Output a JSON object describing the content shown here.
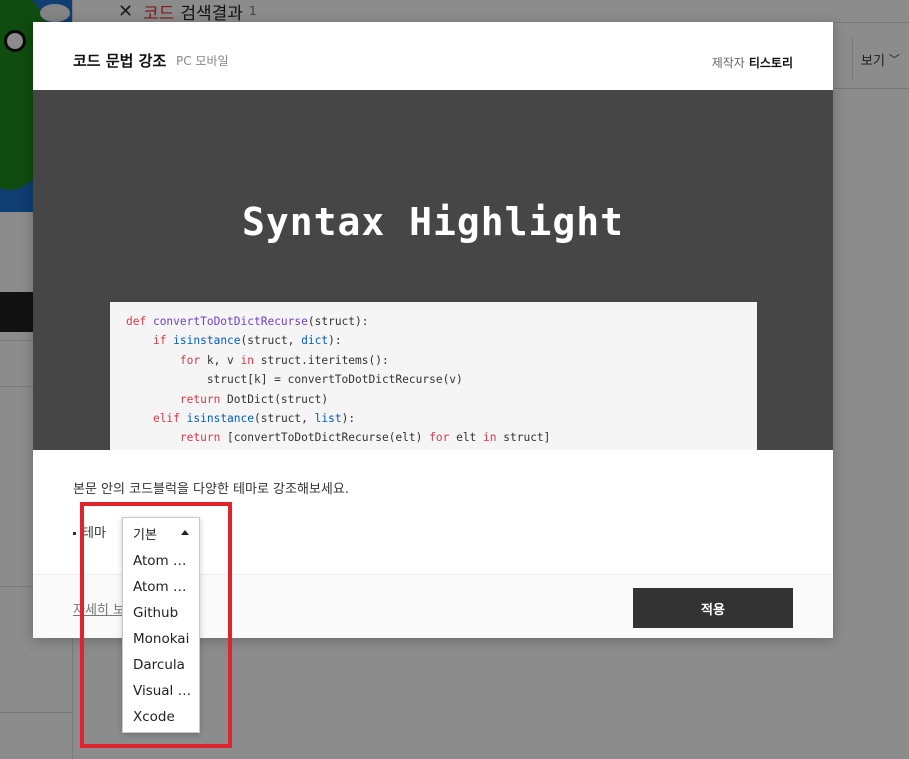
{
  "background": {
    "search_close_glyph": "✕",
    "search_keyword": "코드",
    "search_title": "검색결과",
    "search_count": "1",
    "view_label": "보기",
    "view_chevron": "﹀"
  },
  "modal": {
    "title": "코드 문법 강조",
    "platform": "PC 모바일",
    "maker_label": "제작자",
    "maker_name": "티스토리",
    "preview_heading": "Syntax Highlight",
    "description": "본문 안의 코드블럭을 다양한 테마로 강조해보세요.",
    "theme_label": "테마",
    "more_link": "자세히 보기",
    "apply_button": "적용"
  },
  "code_lines": [
    [
      {
        "t": "def ",
        "c": "kw-red"
      },
      {
        "t": "convertToDotDictRecurse",
        "c": "fn-purple"
      },
      {
        "t": "(struct):",
        "c": ""
      }
    ],
    [
      {
        "t": "    ",
        "c": ""
      },
      {
        "t": "if ",
        "c": "kw-red"
      },
      {
        "t": "isinstance",
        "c": "bi-blue"
      },
      {
        "t": "(struct, ",
        "c": ""
      },
      {
        "t": "dict",
        "c": "bi-blue"
      },
      {
        "t": "):",
        "c": ""
      }
    ],
    [
      {
        "t": "        ",
        "c": ""
      },
      {
        "t": "for ",
        "c": "kw-red"
      },
      {
        "t": "k, v ",
        "c": ""
      },
      {
        "t": "in ",
        "c": "kw-red"
      },
      {
        "t": "struct.iteritems():",
        "c": ""
      }
    ],
    [
      {
        "t": "            struct[k] = convertToDotDictRecurse(v)",
        "c": ""
      }
    ],
    [
      {
        "t": "        ",
        "c": ""
      },
      {
        "t": "return ",
        "c": "kw-red"
      },
      {
        "t": "DotDict(struct)",
        "c": ""
      }
    ],
    [
      {
        "t": "    ",
        "c": ""
      },
      {
        "t": "elif ",
        "c": "kw-red"
      },
      {
        "t": "isinstance",
        "c": "bi-blue"
      },
      {
        "t": "(struct, ",
        "c": ""
      },
      {
        "t": "list",
        "c": "bi-blue"
      },
      {
        "t": "):",
        "c": ""
      }
    ],
    [
      {
        "t": "        ",
        "c": ""
      },
      {
        "t": "return ",
        "c": "kw-red"
      },
      {
        "t": "[convertToDotDictRecurse(elt) ",
        "c": ""
      },
      {
        "t": "for ",
        "c": "kw-red"
      },
      {
        "t": "elt ",
        "c": ""
      },
      {
        "t": "in ",
        "c": "kw-red"
      },
      {
        "t": "struct]",
        "c": ""
      }
    ]
  ],
  "dropdown": {
    "selected": "기본",
    "options": [
      "Atom One Light",
      "Atom One Dark",
      "Github",
      "Monokai",
      "Darcula",
      "Visual Studio",
      "Xcode"
    ]
  },
  "colors": {
    "annotation": "#e0242b",
    "apply_bg": "#333333",
    "preview_bg": "#464646",
    "keyword": "#d73a49",
    "function": "#6f42c1",
    "builtin": "#005cc5"
  }
}
